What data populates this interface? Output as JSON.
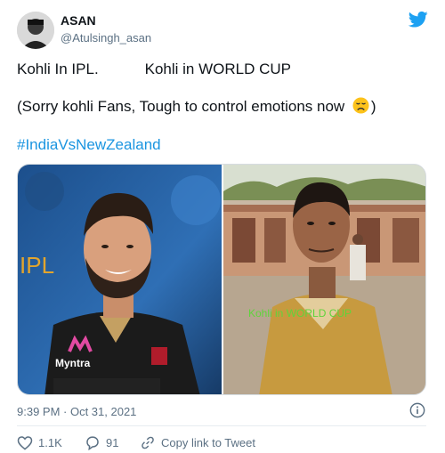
{
  "user": {
    "name": "ASAN",
    "handle": "@Atulsingh_asan"
  },
  "tweet": {
    "line1": "Kohli In IPL.           Kohli in WORLD CUP",
    "line2_before": "(Sorry kohli Fans, Tough to control emotions now ",
    "line2_after": ")",
    "hashtag": "#IndiaVsNewZealand",
    "emoji": "disappointed-face"
  },
  "media": {
    "left_label": "IPL",
    "right_label": "Kohli in WORLD CUP",
    "jersey_text": "Myntra"
  },
  "meta": {
    "timestamp": "9:39 PM · Oct 31, 2021"
  },
  "actions": {
    "likes": "1.1K",
    "replies": "91",
    "copy_link": "Copy link to Tweet"
  },
  "colors": {
    "link": "#1b95e0",
    "muted": "#5b7083",
    "ipl_label": "#e3a52d",
    "wc_label": "#5fd43b"
  }
}
